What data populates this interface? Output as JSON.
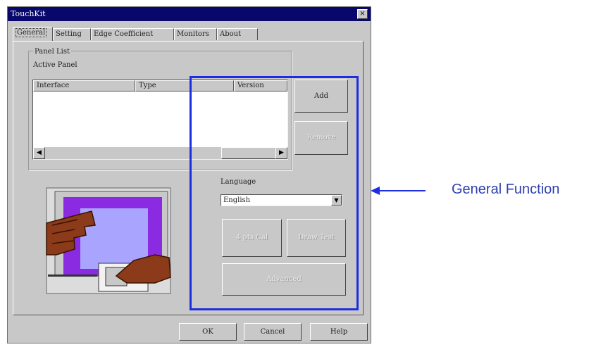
{
  "window": {
    "title": "TouchKit",
    "close_glyph": "×"
  },
  "tabs": [
    {
      "label": "General",
      "active": true
    },
    {
      "label": "Setting",
      "active": false
    },
    {
      "label": "Edge Coefficient",
      "active": false
    },
    {
      "label": "Monitors",
      "active": false
    },
    {
      "label": "About",
      "active": false
    }
  ],
  "panel": {
    "group_label": "Panel List",
    "active_panel_label": "Active Panel",
    "columns": [
      "Interface",
      "Type",
      "Version"
    ],
    "scroll_left": "◀",
    "scroll_right": "▶"
  },
  "buttons": {
    "add": "Add",
    "remove": "Remove",
    "four_pt_cal": "4 pts Cal",
    "draw_test": "Draw Test",
    "advanced": "Advanced",
    "ok": "OK",
    "cancel": "Cancel",
    "help": "Help"
  },
  "language": {
    "label": "Language",
    "value": "English",
    "dropdown_glyph": "▼"
  },
  "annotation": {
    "label": "General Function",
    "color": "#1f2de0"
  },
  "icons": [
    "close-icon",
    "scroll-left-icon",
    "scroll-right-icon",
    "dropdown-arrow-icon",
    "touch-hand-illustration",
    "arrow-left-icon"
  ]
}
